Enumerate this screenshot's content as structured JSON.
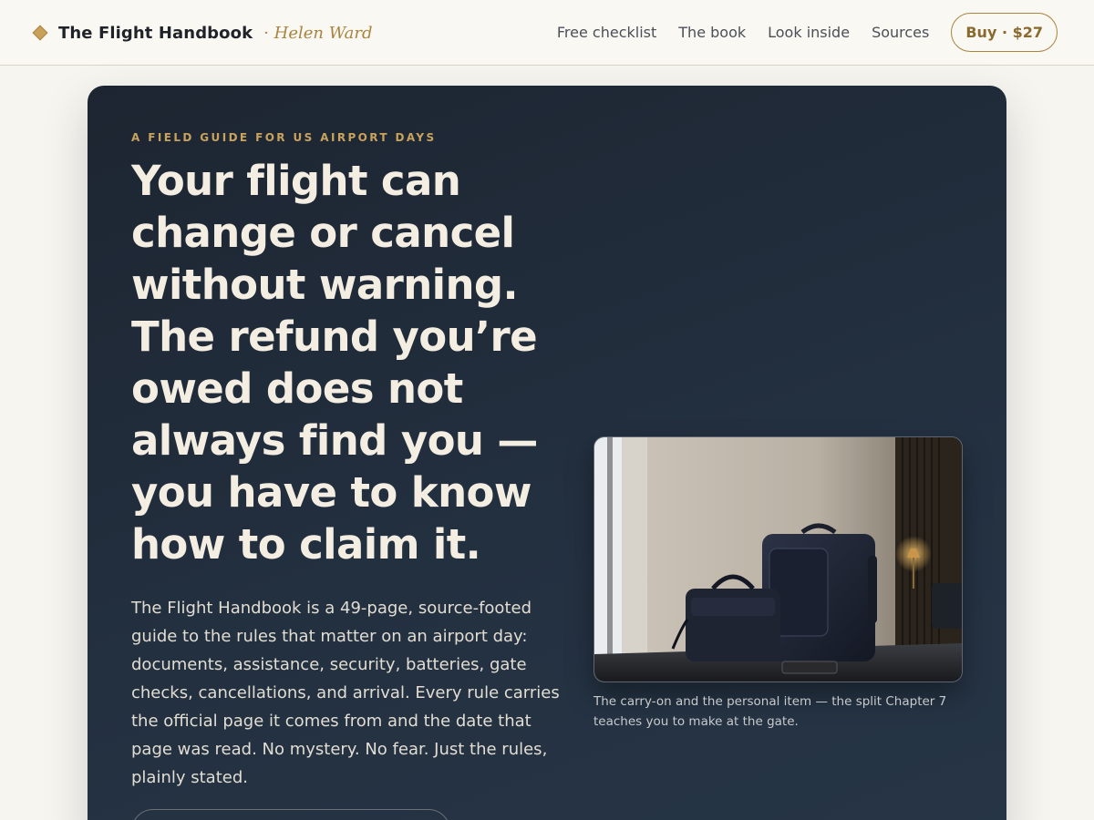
{
  "header": {
    "brand_title": "The Flight Handbook",
    "brand_author": "· Helen Ward",
    "nav": [
      "Free checklist",
      "The book",
      "Look inside",
      "Sources"
    ],
    "buy_label": "Buy · $27"
  },
  "hero": {
    "eyebrow": "A FIELD GUIDE FOR US AIRPORT DAYS",
    "headline": "Your flight can change or cancel without warning. The refund you’re owed does not always find you — you have to know how to claim it.",
    "description": "The Flight Handbook is a 49-page, source-footed guide to the rules that matter on an airport day: documents, assistance, security, batteries, gate checks, cancellations, and arrival. Every rule carries the official page it comes from and the date that page was read. No mystery. No fear. Just the rules, plainly stated.",
    "image_caption": "The carry-on and the personal item — the split Chapter 7 teaches you to make at the gate."
  },
  "colors": {
    "accent": "#c9a35c",
    "hero_background": "#1f2834",
    "page_background": "#f7f5ef"
  }
}
